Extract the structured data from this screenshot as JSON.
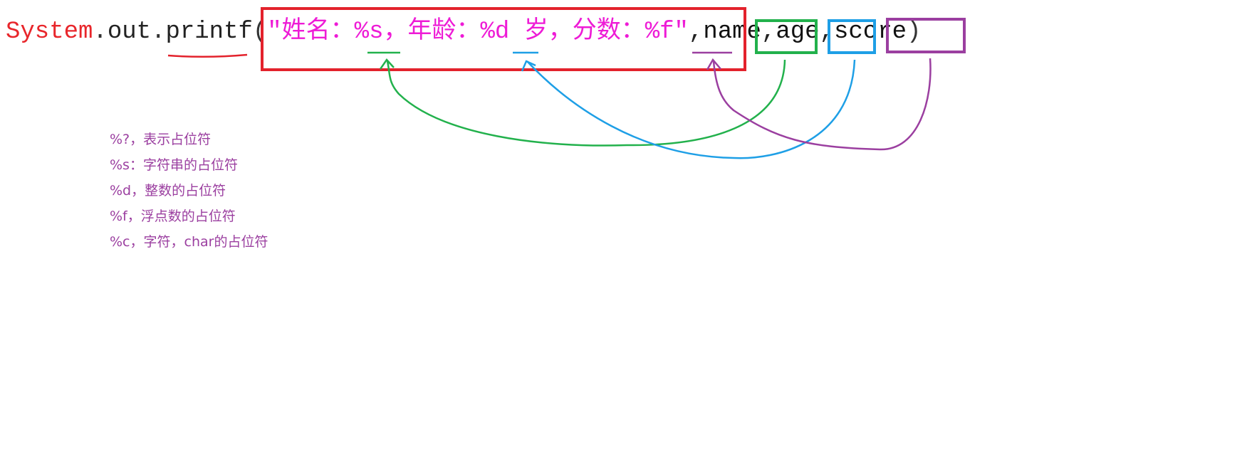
{
  "code": {
    "class_token": "System",
    "dot1": ".",
    "field_token": "out",
    "dot2": ".",
    "method_token": "printf",
    "open_paren": "(",
    "format_string": "\"姓名：%s，年龄：%d 岁，分数：%f\"",
    "comma1": ",",
    "arg_name": "name",
    "comma2": ",",
    "arg_age": "age",
    "comma3": ",",
    "arg_score": "score",
    "close_paren": ")"
  },
  "notes": [
    "%?，表示占位符",
    "%s：字符串的占位符",
    "%d，整数的占位符",
    "%f，浮点数的占位符",
    "%c，字符，char的占位符"
  ],
  "colors": {
    "format_box": "#e3222c",
    "name_box": "#22b14c",
    "age_box": "#1e9fe6",
    "score_box": "#9b3fa0",
    "string_text": "#ee1bd6",
    "system_text": "#e8262b",
    "notes_text": "#9b3fa0"
  }
}
